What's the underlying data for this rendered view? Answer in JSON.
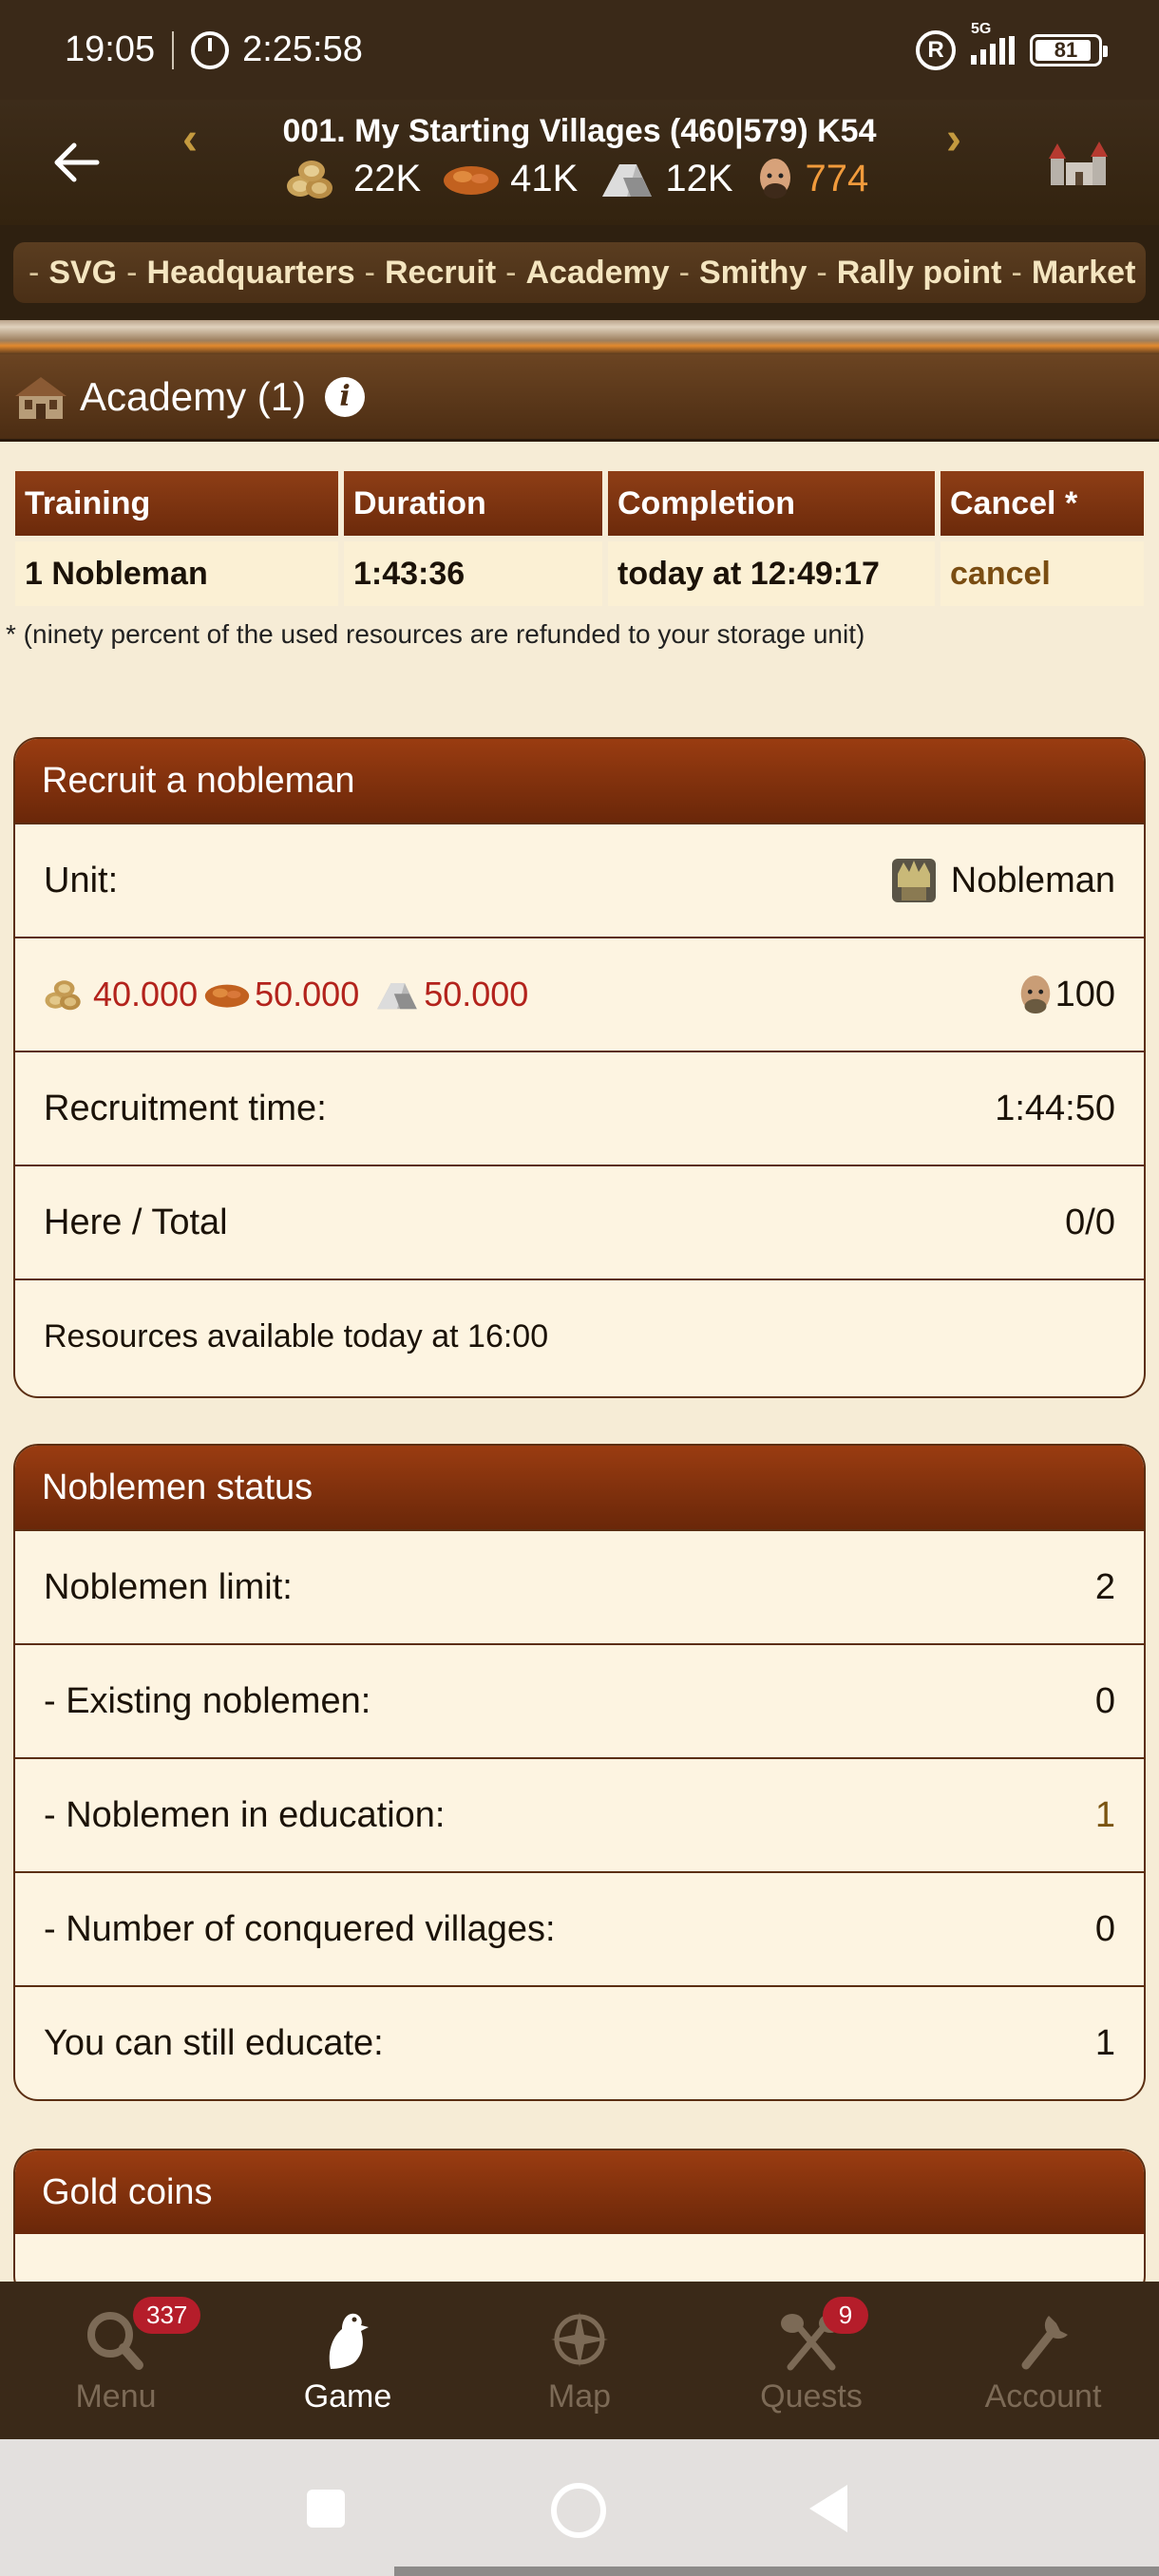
{
  "status_bar": {
    "time": "19:05",
    "timer": "2:25:58",
    "network": "5G",
    "battery": "81"
  },
  "header": {
    "village_title": "001. My Starting Villages (460|579) K54",
    "resources": {
      "wood": "22K",
      "clay": "41K",
      "iron": "12K",
      "population": "774"
    },
    "colors": {
      "population": "#f19b3c",
      "arrows": "#c49a3f"
    }
  },
  "breadcrumb": {
    "items": [
      "SVG",
      "Headquarters",
      "Recruit",
      "Academy",
      "Smithy",
      "Rally point",
      "Market"
    ],
    "more": "»"
  },
  "building": {
    "title": "Academy (1)",
    "info_label": "i"
  },
  "training_table": {
    "headers": [
      "Training",
      "Duration",
      "Completion",
      "Cancel *"
    ],
    "rows": [
      {
        "training": "1 Nobleman",
        "duration": "1:43:36",
        "completion": "today at 12:49:17",
        "cancel": "cancel"
      }
    ],
    "footnote": "* (ninety percent of the used resources are refunded to your storage unit)"
  },
  "recruit_panel": {
    "title": "Recruit a nobleman",
    "unit_label": "Unit:",
    "unit_name": "Nobleman",
    "cost_wood": "40.000",
    "cost_clay": "50.000",
    "cost_iron": "50.000",
    "cost_pop": "100",
    "recruit_time_label": "Recruitment time:",
    "recruit_time": "1:44:50",
    "here_total_label": "Here / Total",
    "here_total": "0/0",
    "availability": "Resources available today at 16:00",
    "cost_color": "#b3231c"
  },
  "noblemen_status": {
    "title": "Noblemen status",
    "rows": [
      {
        "label": "Noblemen limit:",
        "value": "2"
      },
      {
        "label": "- Existing noblemen:",
        "value": "0"
      },
      {
        "label": "- Noblemen in education:",
        "value": "1"
      },
      {
        "label": "- Number of conquered villages:",
        "value": "0"
      },
      {
        "label": "You can still educate:",
        "value": "1"
      }
    ]
  },
  "gold_panel": {
    "title": "Gold coins"
  },
  "bottom_nav": {
    "items": [
      {
        "label": "Menu",
        "badge": "337",
        "icon": "magnifier-icon"
      },
      {
        "label": "Game",
        "badge": "",
        "icon": "raven-icon"
      },
      {
        "label": "Map",
        "badge": "",
        "icon": "compass-icon"
      },
      {
        "label": "Quests",
        "badge": "9",
        "icon": "crossed-axes-icon"
      },
      {
        "label": "Account",
        "badge": "",
        "icon": "wrench-icon"
      }
    ],
    "active": "Game",
    "badge_color": "#b51d2a"
  }
}
